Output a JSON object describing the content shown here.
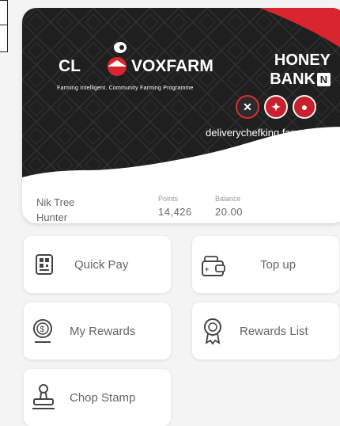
{
  "card": {
    "brand_left": "CL",
    "brand_right": "VOXFARM",
    "tagline": "Farming Intelligent. Community Farming Programme",
    "bank_line1": "HONEY",
    "bank_line2": "BANK",
    "bank_badge": "N",
    "coins": [
      "✕",
      "✦",
      "●"
    ],
    "domain": "deliverychefking.farm"
  },
  "account": {
    "name_line1": "Nik Tree",
    "name_line2": "Hunter",
    "points_label": "Points",
    "points_value": "14,426",
    "balance_label": "Balance",
    "balance_value": "20.00"
  },
  "actions": {
    "quick_pay": "Quick Pay",
    "top_up": "Top up",
    "my_rewards": "My Rewards",
    "rewards_list": "Rewards List",
    "chop_stamp": "Chop Stamp"
  },
  "colors": {
    "accent": "#d9252e",
    "card_dark": "#1f1f1f"
  }
}
